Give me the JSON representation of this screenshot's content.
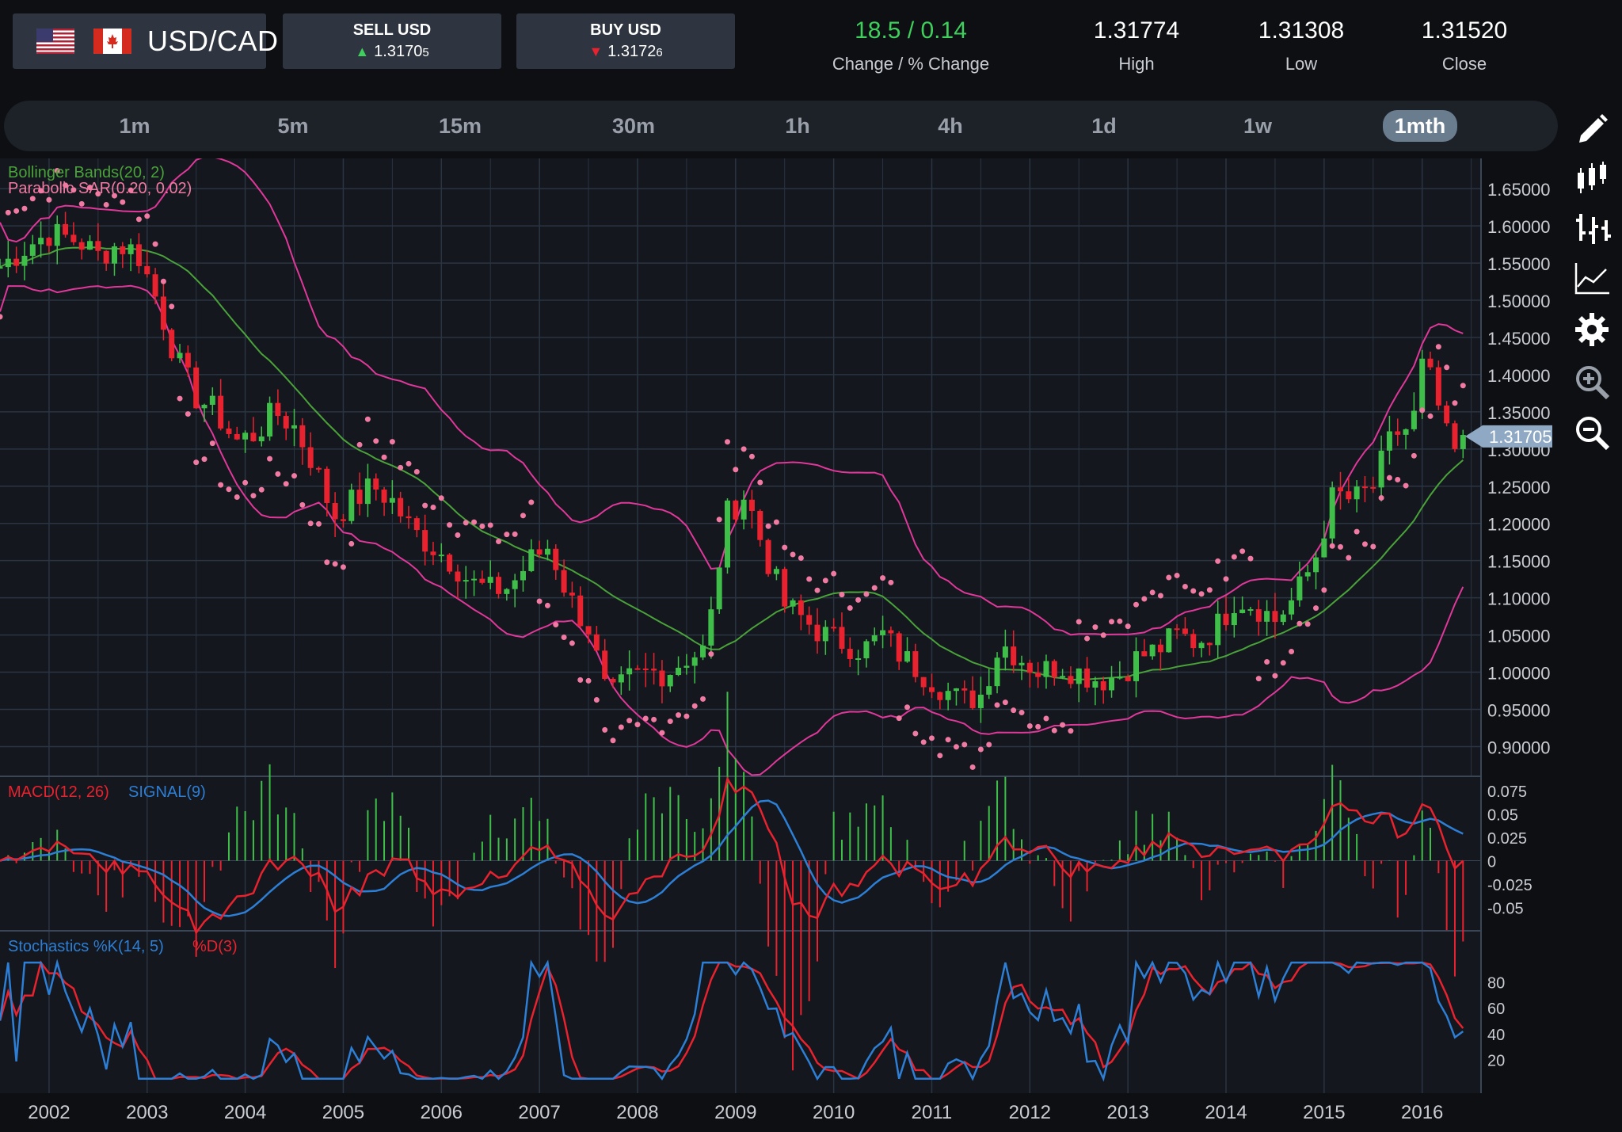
{
  "header": {
    "pair": "USD/CAD",
    "sell": {
      "label": "SELL USD",
      "price": "1.3170",
      "pip": "5"
    },
    "buy": {
      "label": "BUY USD",
      "price": "1.3172",
      "pip": "6"
    },
    "change": {
      "value": "18.5 / 0.14",
      "label": "Change / % Change"
    },
    "high": {
      "value": "1.31774",
      "label": "High"
    },
    "low": {
      "value": "1.31308",
      "label": "Low"
    },
    "close": {
      "value": "1.31520",
      "label": "Close"
    }
  },
  "timeframes": [
    "1m",
    "5m",
    "15m",
    "30m",
    "1h",
    "4h",
    "1d",
    "1w",
    "1mth"
  ],
  "active_timeframe": "1mth",
  "toolbar": [
    "pencil-icon",
    "candlestick-icon",
    "ohlc-bars-icon",
    "line-chart-icon",
    "gear-icon",
    "zoom-in-icon",
    "zoom-out-icon"
  ],
  "colors": {
    "up": "#3fbf4a",
    "down": "#e8222e",
    "bb": "#e0389a",
    "sma": "#4aa23a",
    "sar": "#f07aa2",
    "macd": "#e8222e",
    "signal": "#2d7fd6",
    "stoch_k": "#2d7fd6",
    "stoch_d": "#e8222e",
    "grid": "#2a3442",
    "bg": "#14171d"
  },
  "chart_data": {
    "type": "candlestick",
    "symbol": "USD/CAD",
    "interval": "1mth",
    "x_range": [
      2001.5,
      2016.6
    ],
    "x_ticks": [
      "2002",
      "2003",
      "2004",
      "2005",
      "2006",
      "2007",
      "2008",
      "2009",
      "2010",
      "2011",
      "2012",
      "2013",
      "2014",
      "2015",
      "2016"
    ],
    "price_panel": {
      "ylim": [
        0.86,
        1.68
      ],
      "y_ticks": [
        "1.65000",
        "1.60000",
        "1.55000",
        "1.50000",
        "1.45000",
        "1.40000",
        "1.35000",
        "1.30000",
        "1.25000",
        "1.20000",
        "1.15000",
        "1.10000",
        "1.05000",
        "1.00000",
        "0.95000",
        "0.90000"
      ],
      "current_price": "1.31705",
      "indicator_labels": [
        "Bollinger Bands(20, 2)",
        "Parabolic SAR(0.20, 0.02)"
      ],
      "closes": [
        [
          2001.5,
          1.545
        ],
        [
          2001.8,
          1.575
        ],
        [
          2002.0,
          1.59
        ],
        [
          2002.3,
          1.58
        ],
        [
          2002.5,
          1.56
        ],
        [
          2002.7,
          1.575
        ],
        [
          2002.9,
          1.565
        ],
        [
          2003.1,
          1.5
        ],
        [
          2003.3,
          1.42
        ],
        [
          2003.5,
          1.37
        ],
        [
          2003.7,
          1.35
        ],
        [
          2003.9,
          1.31
        ],
        [
          2004.1,
          1.32
        ],
        [
          2004.3,
          1.35
        ],
        [
          2004.5,
          1.33
        ],
        [
          2004.7,
          1.28
        ],
        [
          2004.9,
          1.21
        ],
        [
          2005.1,
          1.23
        ],
        [
          2005.3,
          1.25
        ],
        [
          2005.5,
          1.23
        ],
        [
          2005.7,
          1.19
        ],
        [
          2005.9,
          1.17
        ],
        [
          2006.1,
          1.15
        ],
        [
          2006.3,
          1.12
        ],
        [
          2006.5,
          1.11
        ],
        [
          2006.7,
          1.115
        ],
        [
          2006.9,
          1.15
        ],
        [
          2007.1,
          1.17
        ],
        [
          2007.3,
          1.1
        ],
        [
          2007.5,
          1.06
        ],
        [
          2007.7,
          0.96
        ],
        [
          2007.9,
          0.99
        ],
        [
          2008.1,
          1.0
        ],
        [
          2008.3,
          1.0
        ],
        [
          2008.5,
          1.02
        ],
        [
          2008.7,
          1.03
        ],
        [
          2008.9,
          1.21
        ],
        [
          2009.1,
          1.24
        ],
        [
          2009.3,
          1.16
        ],
        [
          2009.5,
          1.09
        ],
        [
          2009.7,
          1.07
        ],
        [
          2009.9,
          1.05
        ],
        [
          2010.1,
          1.04
        ],
        [
          2010.3,
          1.03
        ],
        [
          2010.5,
          1.05
        ],
        [
          2010.7,
          1.02
        ],
        [
          2010.9,
          1.0
        ],
        [
          2011.1,
          0.98
        ],
        [
          2011.3,
          0.96
        ],
        [
          2011.5,
          0.97
        ],
        [
          2011.7,
          1.04
        ],
        [
          2011.9,
          1.02
        ],
        [
          2012.1,
          1.0
        ],
        [
          2012.3,
          1.01
        ],
        [
          2012.5,
          1.0
        ],
        [
          2012.7,
          0.99
        ],
        [
          2012.9,
          0.995
        ],
        [
          2013.1,
          1.02
        ],
        [
          2013.3,
          1.03
        ],
        [
          2013.5,
          1.05
        ],
        [
          2013.7,
          1.04
        ],
        [
          2013.9,
          1.06
        ],
        [
          2014.1,
          1.1
        ],
        [
          2014.3,
          1.09
        ],
        [
          2014.5,
          1.07
        ],
        [
          2014.7,
          1.1
        ],
        [
          2014.9,
          1.15
        ],
        [
          2015.1,
          1.24
        ],
        [
          2015.3,
          1.23
        ],
        [
          2015.5,
          1.25
        ],
        [
          2015.7,
          1.32
        ],
        [
          2015.9,
          1.33
        ],
        [
          2016.0,
          1.41
        ],
        [
          2016.1,
          1.39
        ],
        [
          2016.3,
          1.29
        ],
        [
          2016.5,
          1.317
        ]
      ]
    },
    "macd_panel": {
      "label_macd": "MACD(12, 26)",
      "label_signal": "SIGNAL(9)",
      "ylim": [
        -0.075,
        0.08
      ],
      "y_ticks": [
        "0.075",
        "0.05",
        "0.025",
        "0",
        "-0.025",
        "-0.05"
      ]
    },
    "stoch_panel": {
      "label_k": "Stochastics %K(14, 5)",
      "label_d": "%D(3)",
      "ylim": [
        0,
        100
      ],
      "y_ticks": [
        "80",
        "60",
        "40",
        "20"
      ]
    }
  }
}
